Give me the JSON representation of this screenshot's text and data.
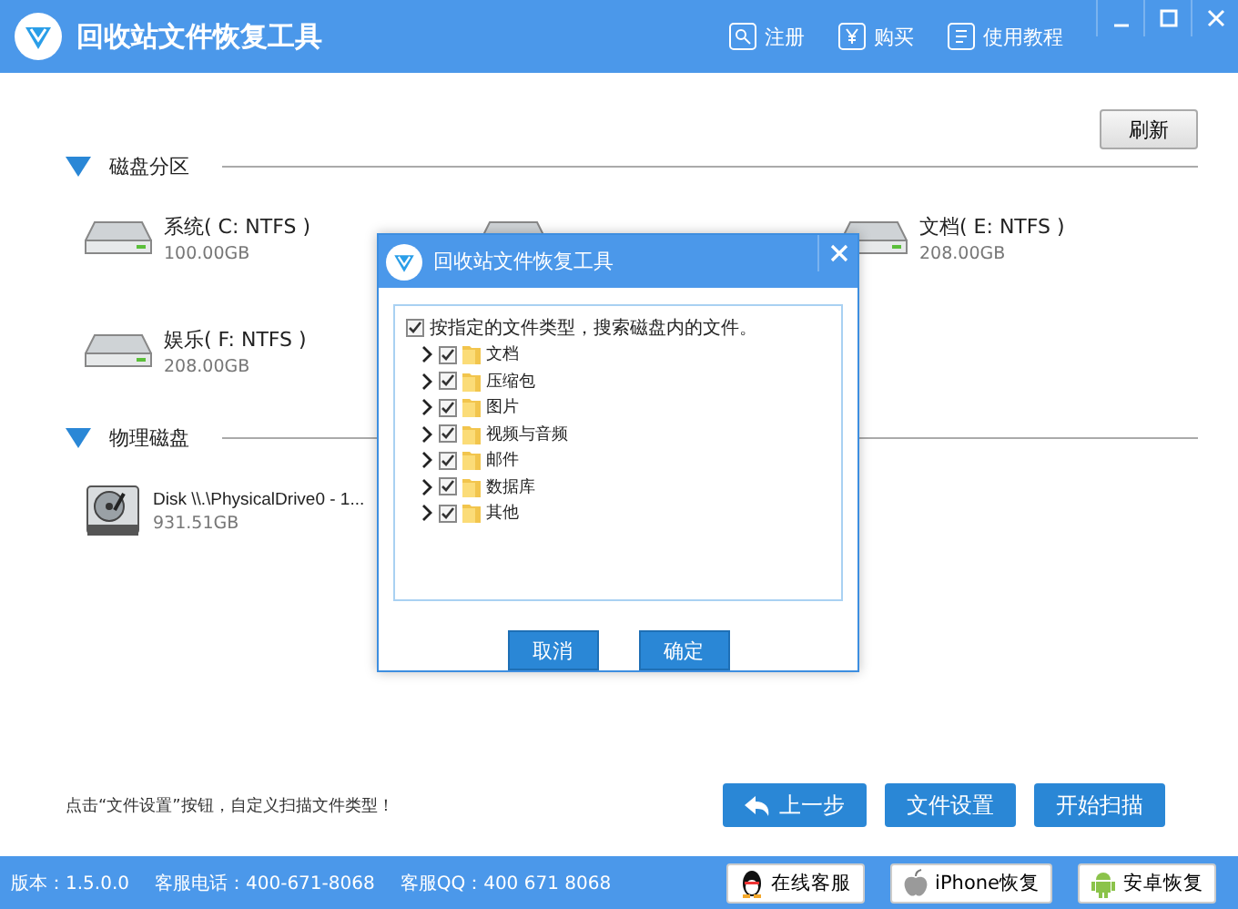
{
  "window": {
    "title": "回收站文件恢复工具",
    "links": [
      "注册",
      "购买",
      "使用教程"
    ]
  },
  "refresh_button": "刷新",
  "sections": [
    {
      "title": "磁盘分区",
      "drives": [
        {
          "kind": "partition",
          "name": "系统( C: NTFS )",
          "size": "100.00GB"
        },
        {
          "kind": "partition"
        },
        {
          "kind": "partition",
          "name": "文档( E: NTFS )",
          "size": "208.00GB"
        },
        {
          "kind": "partition",
          "name": "娱乐( F: NTFS )",
          "size": "208.00GB"
        }
      ]
    },
    {
      "title": "物理磁盘",
      "drives": [
        {
          "kind": "physical",
          "name": "Disk \\\\.\\PhysicalDrive0 - 1...",
          "size": "931.51GB"
        }
      ]
    }
  ],
  "dialog": {
    "title": "回收站文件恢复工具",
    "root": {
      "label": "按指定的文件类型，搜索磁盘内的文件。",
      "checked": true,
      "children": [
        {
          "label": "文档",
          "checked": true,
          "expanded": false
        },
        {
          "label": "压缩包",
          "checked": true,
          "expanded": false
        },
        {
          "label": "图片",
          "checked": true,
          "expanded": false
        },
        {
          "label": "视频与音频",
          "checked": true,
          "expanded": false
        },
        {
          "label": "邮件",
          "checked": true,
          "expanded": false
        },
        {
          "label": "数据库",
          "checked": true,
          "expanded": false
        },
        {
          "label": "其他",
          "checked": true,
          "expanded": false
        }
      ]
    },
    "buttons": [
      "取消",
      "确定"
    ]
  },
  "hint": "点击“文件设置”按钮，自定义扫描文件类型！",
  "actions": [
    "上一步",
    "文件设置",
    "开始扫描"
  ],
  "status_bar": {
    "version": "版本：1.5.0.0",
    "phone": "客服电话：400-671-8068",
    "qq": "客服QQ：400 671 8068",
    "buttons": [
      {
        "kind": "qq",
        "label": "在线客服"
      },
      {
        "kind": "apple",
        "label": "iPhone恢复"
      },
      {
        "kind": "android",
        "label": "安卓恢复"
      }
    ]
  }
}
